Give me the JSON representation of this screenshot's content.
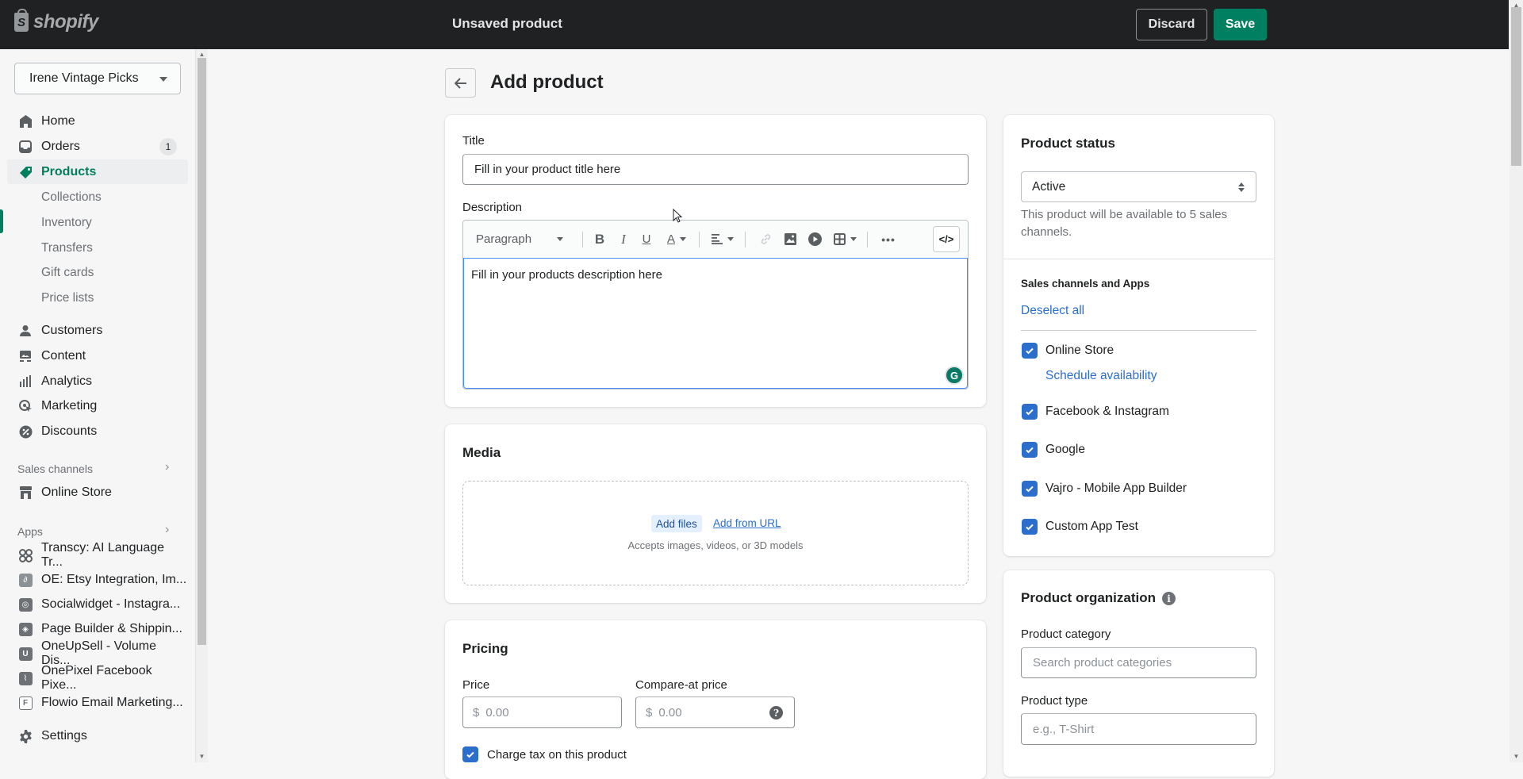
{
  "topbar": {
    "logo_text": "shopify",
    "title": "Unsaved product",
    "discard_label": "Discard",
    "save_label": "Save",
    "save_color": "#008060"
  },
  "sidebar": {
    "store_name": "Irene Vintage Picks",
    "items": [
      {
        "label": "Home",
        "icon": "home-icon"
      },
      {
        "label": "Orders",
        "icon": "inbox-icon",
        "badge": "1"
      },
      {
        "label": "Products",
        "icon": "tag-icon",
        "active": true
      },
      {
        "label": "Collections"
      },
      {
        "label": "Inventory"
      },
      {
        "label": "Transfers"
      },
      {
        "label": "Gift cards"
      },
      {
        "label": "Price lists"
      },
      {
        "label": "Customers",
        "icon": "person-icon"
      },
      {
        "label": "Content",
        "icon": "content-icon"
      },
      {
        "label": "Analytics",
        "icon": "bar-chart-icon"
      },
      {
        "label": "Marketing",
        "icon": "target-icon"
      },
      {
        "label": "Discounts",
        "icon": "discount-icon"
      }
    ],
    "sales_channels_label": "Sales channels",
    "sales_channels": [
      {
        "label": "Online Store",
        "icon": "store-icon"
      }
    ],
    "apps_label": "Apps",
    "apps": [
      {
        "label": "Transcy: AI Language Tr...",
        "icon": "transcy-icon"
      },
      {
        "label": "OE: Etsy Integration, Im...",
        "icon": "etsy-icon"
      },
      {
        "label": "Socialwidget - Instagra...",
        "icon": "socialwidget-icon"
      },
      {
        "label": "Page Builder & Shippin...",
        "icon": "pagebuilder-icon"
      },
      {
        "label": "OneUpSell - Volume Dis...",
        "icon": "oneupsell-icon"
      },
      {
        "label": "OnePixel Facebook Pixe...",
        "icon": "onepixel-icon"
      },
      {
        "label": "Flowio Email Marketing...",
        "icon": "flowio-icon"
      }
    ],
    "settings_label": "Settings"
  },
  "main": {
    "page_title": "Add product",
    "title_card": {
      "title_label": "Title",
      "title_value": "Fill in your product title here",
      "description_label": "Description",
      "paragraph_label": "Paragraph",
      "description_value": "Fill in your products description here"
    },
    "media": {
      "heading": "Media",
      "add_files": "Add files",
      "add_from_url": "Add from URL",
      "accepts": "Accepts images, videos, or 3D models"
    },
    "pricing": {
      "heading": "Pricing",
      "price_label": "Price",
      "price_currency": "$",
      "price_placeholder": "0.00",
      "compare_label": "Compare-at price",
      "compare_currency": "$",
      "compare_placeholder": "0.00",
      "charge_tax_label": "Charge tax on this product",
      "charge_tax_checked": true
    }
  },
  "right": {
    "status": {
      "heading": "Product status",
      "value": "Active",
      "help": "This product will be available to 5 sales channels."
    },
    "channels": {
      "heading": "Sales channels and Apps",
      "deselect_all": "Deselect all",
      "schedule_availability": "Schedule availability",
      "items": [
        {
          "label": "Online Store",
          "checked": true
        },
        {
          "label": "Facebook & Instagram",
          "checked": true
        },
        {
          "label": "Google",
          "checked": true
        },
        {
          "label": "Vajro - Mobile App Builder",
          "checked": true
        },
        {
          "label": "Custom App Test",
          "checked": true
        }
      ]
    },
    "organization": {
      "heading": "Product organization",
      "category_label": "Product category",
      "category_placeholder": "Search product categories",
      "type_label": "Product type",
      "type_placeholder": "e.g., T-Shirt"
    }
  },
  "colors": {
    "accent": "#008060",
    "link": "#2c6ecb",
    "checkbox": "#2c6ecb"
  }
}
